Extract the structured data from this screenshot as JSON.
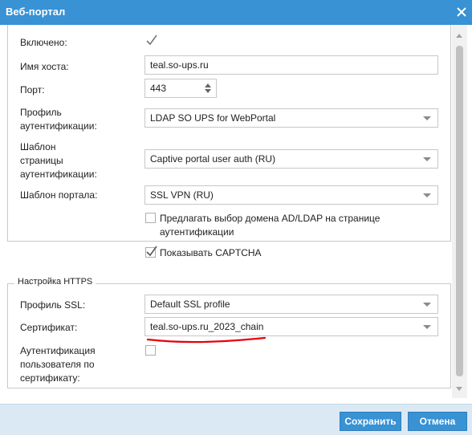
{
  "window": {
    "title": "Веб-портал"
  },
  "general": {
    "enabled_label": "Включено:",
    "enabled_checked": true,
    "hostname_label": "Имя хоста:",
    "hostname_value": "teal.so-ups.ru",
    "port_label": "Порт:",
    "port_value": "443",
    "auth_profile_label_lines": [
      "Профиль",
      "аутентификации:"
    ],
    "auth_profile_value": "LDAP SO UPS for WebPortal",
    "auth_page_template_label_lines": [
      "Шаблон",
      "страницы",
      "аутентификации:"
    ],
    "auth_page_template_value": "Captive portal user auth (RU)",
    "portal_template_label": "Шаблон портала:",
    "portal_template_value": "SSL VPN (RU)",
    "offer_domain_label_lines": [
      "Предлагать выбор домена AD/LDAP на странице",
      "аутентификации"
    ],
    "offer_domain_checked": false,
    "show_captcha_label": "Показывать CAPTCHA",
    "show_captcha_checked": true
  },
  "https": {
    "legend": "Настройка HTTPS",
    "ssl_profile_label": "Профиль SSL:",
    "ssl_profile_value": "Default SSL profile",
    "certificate_label": "Сертификат:",
    "certificate_value": "teal.so-ups.ru_2023_chain",
    "cert_auth_label_lines": [
      "Аутентификация",
      "пользователя по",
      "сертификату:"
    ],
    "cert_auth_checked": false
  },
  "footer": {
    "save_label": "Сохранить",
    "cancel_label": "Отмена"
  },
  "colors": {
    "accent": "#3892d4",
    "annotation": "#e8000b"
  }
}
